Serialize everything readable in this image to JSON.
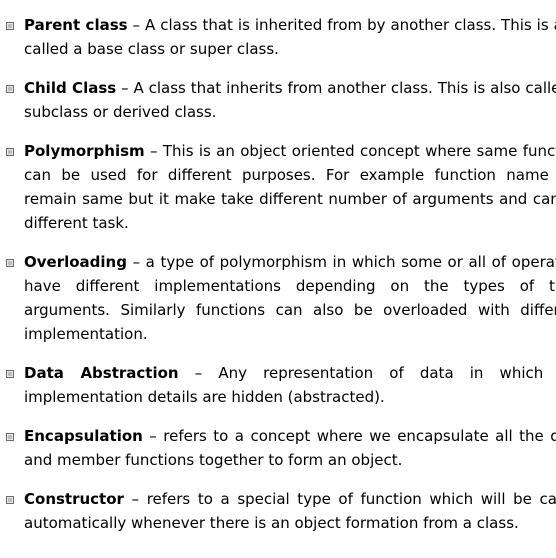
{
  "items": [
    {
      "term": "Parent class",
      "separator": " – ",
      "definition": "A class that is inherited from by another class. This is also called a base class or super class."
    },
    {
      "term": "Child Class",
      "separator": " – ",
      "definition": "A class that inherits from another class. This is also called a subclass or derived class."
    },
    {
      "term": "Polymorphism",
      "separator": " – ",
      "definition": "This is an object oriented concept where same function can be used for different purposes. For example function name will remain same but it make take different number of arguments and can do different task."
    },
    {
      "term": "Overloading",
      "separator": " – ",
      "definition": "a type of polymorphism in which some or all of operators have different implementations depending on the types of their arguments. Similarly functions can also be overloaded with different implementation."
    },
    {
      "term": "Data Abstraction",
      "separator": " – ",
      "definition": "Any representation of data in which the implementation details are hidden (abstracted)."
    },
    {
      "term": "Encapsulation",
      "separator": " – ",
      "definition": "refers to a concept where we encapsulate all the data and member functions together to form an object."
    },
    {
      "term": "Constructor",
      "separator": " – ",
      "definition": "refers to a special type of function which will be called automatically whenever there is an object formation from a class."
    }
  ]
}
